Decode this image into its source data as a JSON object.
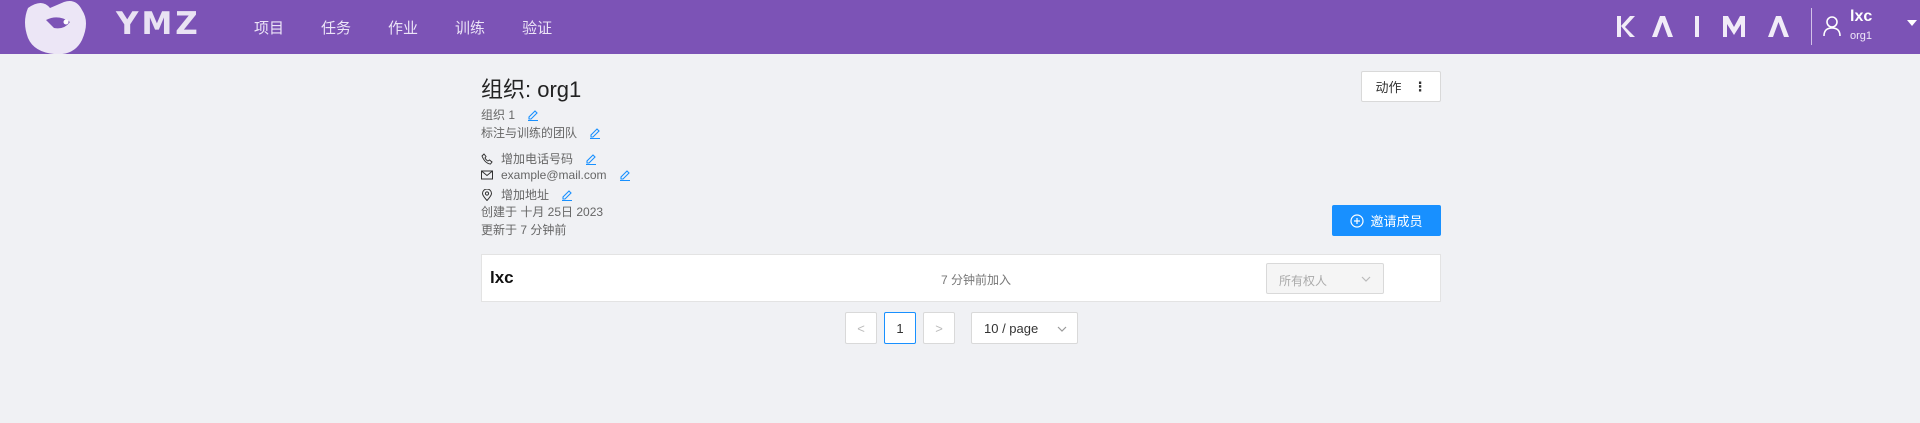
{
  "header": {
    "logo_text": "YMZ",
    "nav": [
      "项目",
      "任务",
      "作业",
      "训练",
      "验证"
    ],
    "brand": "KAIMA",
    "user": {
      "name": "lxc",
      "org": "org1"
    },
    "colors": {
      "header_bg": "#7c53b6",
      "accent": "#1890ff"
    }
  },
  "org": {
    "title": "组织: org1",
    "display_name": "组织 1",
    "description": "标注与训练的团队",
    "phone": "增加电话号码",
    "email": "example@mail.com",
    "address": "增加地址",
    "created": "创建于 十月 25日 2023",
    "updated": "更新于 7 分钟前"
  },
  "actions": {
    "label": "动作",
    "dots": "⋮"
  },
  "invite": {
    "label": "邀请成员"
  },
  "members": [
    {
      "name": "lxc",
      "joined": "7 分钟前加入",
      "role_placeholder": "所有权人"
    }
  ],
  "pagination": {
    "prev": "<",
    "current": "1",
    "next": ">",
    "page_size": "10 / page"
  }
}
